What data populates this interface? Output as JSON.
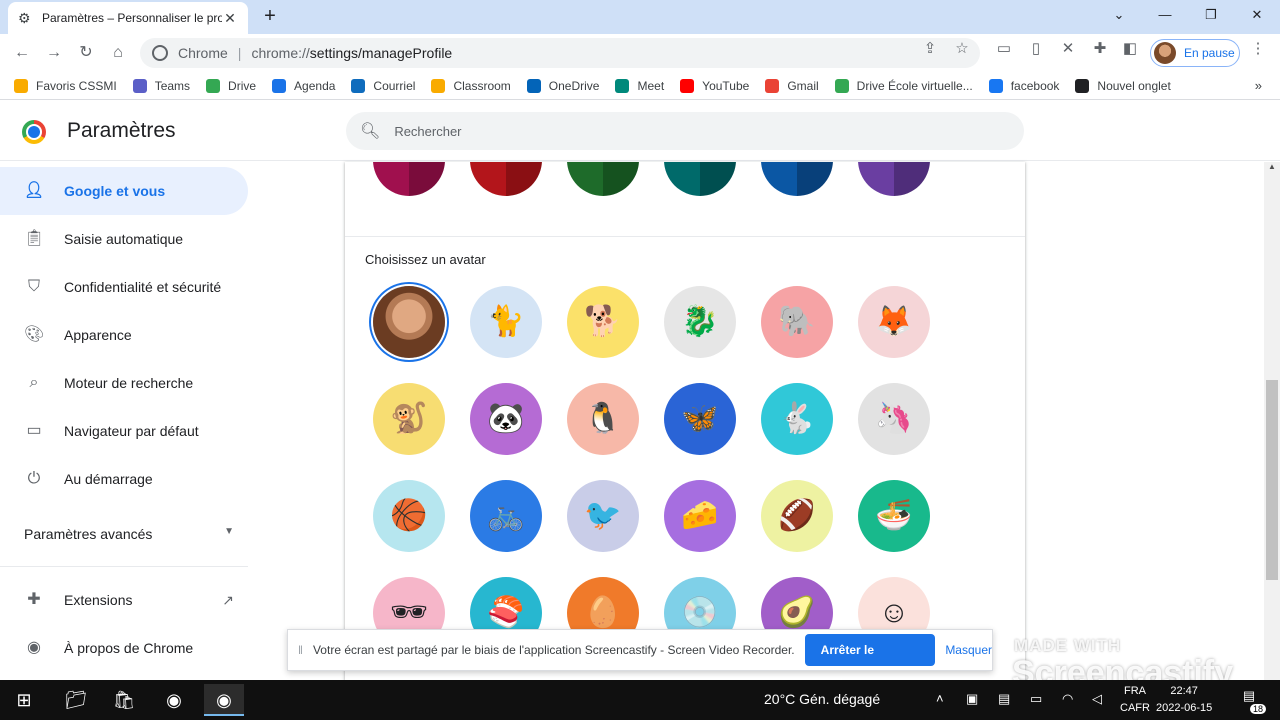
{
  "browser": {
    "tab_title": "Paramètres – Personnaliser le pro",
    "omnibox_site_label": "Chrome",
    "url_scheme": "chrome://",
    "url_path": "settings/manageProfile",
    "profile_status": "En pause"
  },
  "bookmarks": [
    {
      "label": "Favoris CSSMI",
      "color": "#f9ab00"
    },
    {
      "label": "Teams",
      "color": "#5b5fc7"
    },
    {
      "label": "Drive",
      "color": "#34a853"
    },
    {
      "label": "Agenda",
      "color": "#1a73e8"
    },
    {
      "label": "Courriel",
      "color": "#0f6cbd"
    },
    {
      "label": "Classroom",
      "color": "#f9ab00"
    },
    {
      "label": "OneDrive",
      "color": "#0364b8"
    },
    {
      "label": "Meet",
      "color": "#00897b"
    },
    {
      "label": "YouTube",
      "color": "#ff0000"
    },
    {
      "label": "Gmail",
      "color": "#ea4335"
    },
    {
      "label": "Drive École virtuelle...",
      "color": "#34a853"
    },
    {
      "label": "facebook",
      "color": "#1877f2"
    },
    {
      "label": "Nouvel onglet",
      "color": "#202124"
    }
  ],
  "settings": {
    "title": "Paramètres",
    "search_placeholder": "Rechercher"
  },
  "sidebar": {
    "items": [
      {
        "label": "Google et vous",
        "icon": "person-icon",
        "active": true
      },
      {
        "label": "Saisie automatique",
        "icon": "clipboard-icon"
      },
      {
        "label": "Confidentialité et sécurité",
        "icon": "shield-icon"
      },
      {
        "label": "Apparence",
        "icon": "palette-icon"
      },
      {
        "label": "Moteur de recherche",
        "icon": "search-icon"
      },
      {
        "label": "Navigateur par défaut",
        "icon": "browser-icon"
      },
      {
        "label": "Au démarrage",
        "icon": "power-icon"
      }
    ],
    "advanced_label": "Paramètres avancés",
    "extensions_label": "Extensions",
    "about_label": "À propos de Chrome"
  },
  "profile": {
    "avatar_heading": "Choisissez un avatar",
    "theme_colors": [
      {
        "left": "#a0104e",
        "right": "#7a0c3b"
      },
      {
        "left": "#b3151b",
        "right": "#8a0f13"
      },
      {
        "left": "#1e6b2a",
        "right": "#15521f"
      },
      {
        "left": "#006a6a",
        "right": "#004f50"
      },
      {
        "left": "#0b57a4",
        "right": "#08407a"
      },
      {
        "left": "#6a3ea1",
        "right": "#4f2d7a"
      }
    ],
    "avatars": [
      {
        "name": "profile-photo-avatar",
        "bg": "#7a4a2a",
        "glyph": "",
        "selected": true
      },
      {
        "name": "cat-avatar",
        "bg": "#d4e4f5",
        "glyph": "🐈"
      },
      {
        "name": "corgi-avatar",
        "bg": "#fbe16a",
        "glyph": "🐕"
      },
      {
        "name": "dragon-avatar",
        "bg": "#e6e6e6",
        "glyph": "🐉"
      },
      {
        "name": "elephant-avatar",
        "bg": "#f6a3a5",
        "glyph": "🐘"
      },
      {
        "name": "fox-avatar",
        "bg": "#f5d5d7",
        "glyph": "🦊"
      },
      {
        "name": "monkey-avatar",
        "bg": "#f7dd72",
        "glyph": "🐒"
      },
      {
        "name": "panda-avatar",
        "bg": "#b56bd4",
        "glyph": "🐼"
      },
      {
        "name": "penguin-avatar",
        "bg": "#f7b8a8",
        "glyph": "🐧"
      },
      {
        "name": "butterfly-avatar",
        "bg": "#2a64d6",
        "glyph": "🦋"
      },
      {
        "name": "rabbit-avatar",
        "bg": "#30c8d8",
        "glyph": "🐇"
      },
      {
        "name": "unicorn-avatar",
        "bg": "#e2e2e2",
        "glyph": "🦄"
      },
      {
        "name": "basketball-avatar",
        "bg": "#b6e6ef",
        "glyph": "🏀"
      },
      {
        "name": "bike-avatar",
        "bg": "#2b7be5",
        "glyph": "🚲"
      },
      {
        "name": "bird-avatar",
        "bg": "#c9cde8",
        "glyph": "🐦"
      },
      {
        "name": "cheese-avatar",
        "bg": "#a66ee0",
        "glyph": "🧀"
      },
      {
        "name": "football-avatar",
        "bg": "#eef2a2",
        "glyph": "🏈"
      },
      {
        "name": "ramen-avatar",
        "bg": "#18b98c",
        "glyph": "🍜"
      },
      {
        "name": "sunglasses-avatar",
        "bg": "#f6b6c9",
        "glyph": "🕶"
      },
      {
        "name": "sushi-avatar",
        "bg": "#27b7d0",
        "glyph": "🍣"
      },
      {
        "name": "tamagotchi-avatar",
        "bg": "#f07a2a",
        "glyph": "🥚"
      },
      {
        "name": "vinyl-avatar",
        "bg": "#7fd0e8",
        "glyph": "💿"
      },
      {
        "name": "avocado-avatar",
        "bg": "#a15ec9",
        "glyph": "🥑"
      },
      {
        "name": "smiley-avatar",
        "bg": "#fbe1dc",
        "glyph": "☺"
      }
    ]
  },
  "share_banner": {
    "message": "Votre écran est partagé par le biais de l'application Screencastify - Screen Video Recorder.",
    "stop_label": "Arrêter le partage",
    "hide_label": "Masquer"
  },
  "watermark": {
    "made_with": "MADE WITH",
    "brand": "Screencastify"
  },
  "taskbar": {
    "weather": "20°C  Gén. dégagé",
    "lang_line1": "FRA",
    "lang_line2": "CAFR",
    "time": "22:47",
    "date": "2022-06-15",
    "notif_count": "18"
  }
}
